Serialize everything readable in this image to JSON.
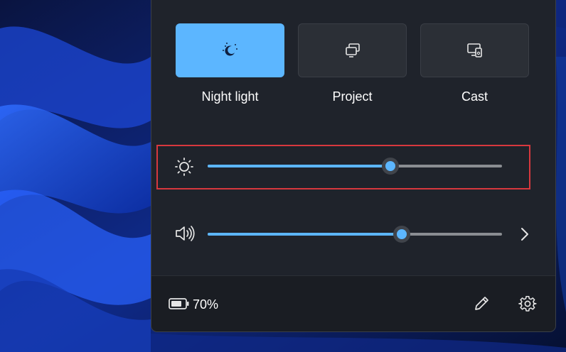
{
  "colors": {
    "accent": "#5cb6ff",
    "panel_bg": "#1f232b",
    "footer_bg": "#1a1d23",
    "highlight": "#d8383e"
  },
  "quick_actions": [
    {
      "label": "Night light",
      "icon": "night-light-icon",
      "active": true
    },
    {
      "label": "Project",
      "icon": "project-icon",
      "active": false
    },
    {
      "label": "Cast",
      "icon": "cast-icon",
      "active": false
    }
  ],
  "brightness": {
    "icon": "brightness-icon",
    "level": 0.62
  },
  "volume": {
    "icon": "speaker-icon",
    "level": 0.66,
    "expand_icon": "chevron-right-icon"
  },
  "footer": {
    "battery_icon": "battery-icon",
    "battery_percent": "70%",
    "edit_icon": "pencil-icon",
    "settings_icon": "gear-icon"
  }
}
